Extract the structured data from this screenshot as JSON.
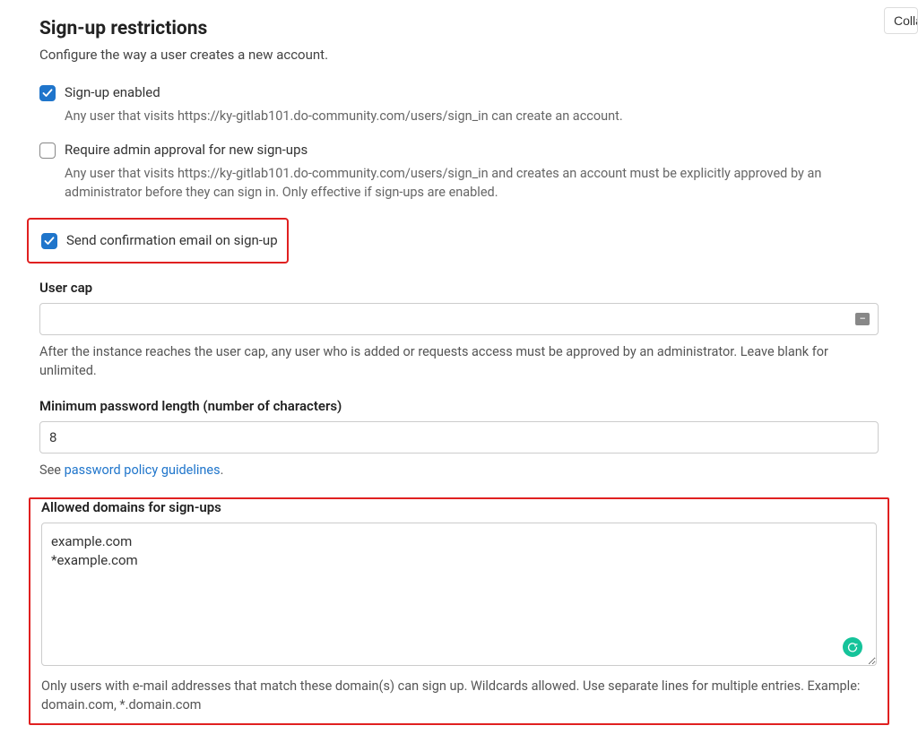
{
  "topRightButton": "Collapse",
  "title": "Sign-up restrictions",
  "subtitle": "Configure the way a user creates a new account.",
  "checkboxes": {
    "signupEnabled": {
      "label": "Sign-up enabled",
      "help": "Any user that visits https://ky-gitlab101.do-community.com/users/sign_in can create an account."
    },
    "requireAdminApproval": {
      "label": "Require admin approval for new sign-ups",
      "help": "Any user that visits https://ky-gitlab101.do-community.com/users/sign_in and creates an account must be explicitly approved by an administrator before they can sign in. Only effective if sign-ups are enabled."
    },
    "sendConfirmationEmail": {
      "label": "Send confirmation email on sign-up"
    }
  },
  "userCap": {
    "label": "User cap",
    "value": "",
    "help": "After the instance reaches the user cap, any user who is added or requests access must be approved by an administrator. Leave blank for unlimited."
  },
  "minPasswordLength": {
    "label": "Minimum password length (number of characters)",
    "value": "8",
    "helpPrefix": "See ",
    "helpLink": "password policy guidelines",
    "helpSuffix": "."
  },
  "allowedDomains": {
    "label": "Allowed domains for sign-ups",
    "value": "example.com\n*example.com",
    "help": "Only users with e-mail addresses that match these domain(s) can sign up. Wildcards allowed. Use separate lines for multiple entries. Example: domain.com, *.domain.com"
  }
}
